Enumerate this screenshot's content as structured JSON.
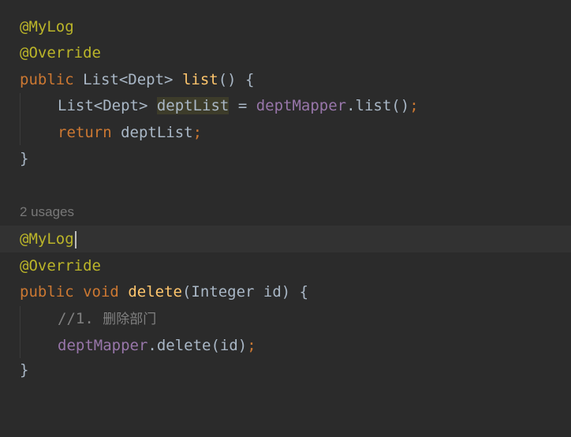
{
  "method1": {
    "annotation_mylog": "@MyLog",
    "annotation_override": "@Override",
    "signature": {
      "public": "public",
      "return_type": "List<Dept>",
      "name": "list",
      "params": "() {"
    },
    "body_line1": {
      "type": "List<Dept>",
      "var": "deptList",
      "assign": "=",
      "mapper": "deptMapper",
      "call": ".list()",
      "semi": ";"
    },
    "body_line2": {
      "return_kw": "return",
      "value": "deptList",
      "semi": ";"
    },
    "close": "}"
  },
  "usages_hint": "2 usages",
  "method2": {
    "annotation_mylog": "@MyLog",
    "annotation_override": "@Override",
    "signature": {
      "public": "public",
      "void": "void",
      "name": "delete",
      "params": "(Integer id) {"
    },
    "comment": {
      "prefix": "//1. ",
      "text": "删除部门"
    },
    "body_line": {
      "mapper": "deptMapper",
      "call": ".delete(id)",
      "semi": ";"
    },
    "close": "}"
  },
  "colors": {
    "background": "#2b2b2b",
    "current_line": "#323232",
    "annotation": "#bbb529",
    "keyword": "#cc7832",
    "function": "#ffc66d",
    "field": "#9876aa",
    "default_text": "#a9b7c6",
    "comment": "#808080"
  }
}
